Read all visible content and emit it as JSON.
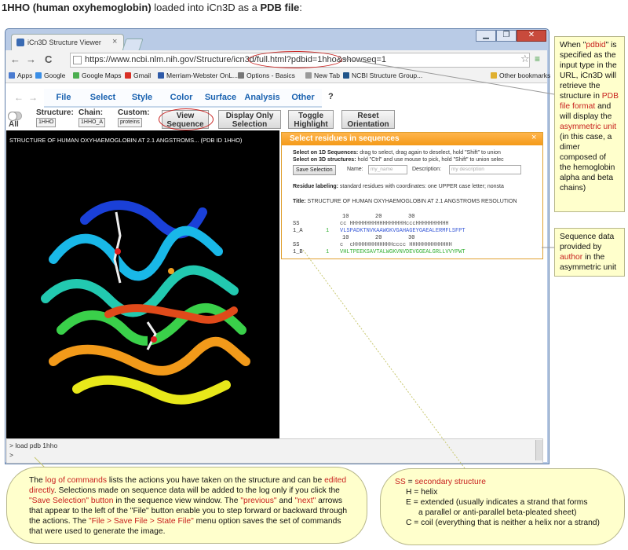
{
  "heading": {
    "bold1": "1HHO (human oxyhemoglobin)",
    "mid": " loaded into iCn3D as a ",
    "bold2": "PDB file",
    "end": ":"
  },
  "browser": {
    "tab_title": "iCn3D Structure Viewer",
    "tab_close": "×",
    "url": "https://www.ncbi.nlm.nih.gov/Structure/icn3d/full.html?pdbid=1hho&showseq=1",
    "back": "←",
    "forward": "→",
    "reload": "C",
    "star": "☆",
    "menu": "≡",
    "win_min": "▁",
    "win_restore": "❐",
    "win_close": "✕",
    "bookmarks": [
      {
        "label": "Apps",
        "color": "#4a7bd0"
      },
      {
        "label": "Google",
        "color": "#3a8ee6"
      },
      {
        "label": "Google Maps",
        "color": "#4caf50"
      },
      {
        "label": "Gmail",
        "color": "#d93025"
      },
      {
        "label": "Merriam-Webster OnL...",
        "color": "#2e5aa8"
      },
      {
        "label": "Options - Basics",
        "color": "#777777"
      },
      {
        "label": "New Tab",
        "color": "#999999"
      },
      {
        "label": "NCBI Structure Group...",
        "color": "#20558a"
      },
      {
        "label": "Other bookmarks",
        "color": "#e0b030"
      }
    ]
  },
  "icn3d": {
    "prev": "←",
    "next": "→",
    "menus": [
      "File",
      "Select",
      "Style",
      "Color",
      "Surface",
      "Analysis",
      "Other"
    ],
    "help": "?",
    "all_label": "All",
    "structure_label": "Structure:",
    "structure_value": "1HHO",
    "chain_label": "Chain:",
    "chain_value": "1HHO_A",
    "custom_label": "Custom:",
    "custom_value": "proteins",
    "buttons": {
      "view_seq_1": "View",
      "view_seq_2": "Sequence",
      "display_only_1": "Display Only",
      "display_only_2": "Selection",
      "toggle_1": "Toggle",
      "toggle_2": "Highlight",
      "reset_1": "Reset",
      "reset_2": "Orientation"
    },
    "viewer_title": "STRUCTURE OF HUMAN OXYHAEMOGLOBIN AT 2.1 ANGSTROMS... (PDB ID 1HHO)",
    "cmd_line1": "> load pdb 1hho",
    "cmd_line2": ">"
  },
  "seq_dialog": {
    "header": "Select residues in sequences",
    "close": "×",
    "line1_b": "Select on 1D Sequences:",
    "line1": " drag to select, drag again to deselect, hold \"Shift\" to union",
    "line2_b": "Select on 3D structures:",
    "line2": " hold \"Ctrl\" and use mouse to pick, hold \"Shift\" to union selec",
    "save_btn": "Save Selection",
    "name_label": "Name:",
    "name_placeholder": "my_name",
    "desc_label": "Description:",
    "desc_placeholder": "my description",
    "residue_b": "Residue labeling:",
    "residue": " standard residues with coordinates: one UPPER case letter; nonsta",
    "title_b": "Title:",
    "title": " STRUCTURE OF HUMAN OXYHAEMOGLOBIN AT 2.1 ANGSTROMS RESOLUTION",
    "ticks": "               10        20        30",
    "ss_label": "SS",
    "ss_a": "cc HHHHHHHHHHHHHHHHHcccHHHHHHHHHH",
    "chain_a": "1_A",
    "num_a": "1",
    "seq_a": "VLSPADKTNVKAAWGKVGAHAGEYGAEALERMFLSFPT",
    "ticks_b": "               10        20        30",
    "ss_b": "c  cHHHHHHHHHHHHcccc HHHHHHHHHHHHH",
    "chain_b": "1_B",
    "num_b": "1",
    "seq_b": "VHLTPEEKSAVTALWGKVNVDEVGGEALGRLLVVYPWT"
  },
  "notes": {
    "right": {
      "p1": "When \"",
      "p2": "pdbid",
      "p3": "\" is specified as the input type in the URL, iCn3D will retrieve the structure in ",
      "p4": "PDB file format",
      "p5": " and will display the ",
      "p6": "asymmetric unit",
      "p7": " (in this case, a dimer composed of the hemoglobin alpha and beta chains)"
    },
    "seq": {
      "p1": "Sequence data provided by ",
      "p2": "author",
      "p3": " in the asymmetric unit"
    },
    "log": {
      "p1": "The ",
      "p2": "log of commands",
      "p3": " lists the actions you have taken on the structure and can be ",
      "p4": "edited directly",
      "p5": ". Selections made on sequence data will be added to the log only if you click the ",
      "p6": "\"Save Selection\" button",
      "p7": " in the sequence view window. The ",
      "p8": "\"previous\"",
      "p9": " and ",
      "p10": "\"next\"",
      "p11": " arrows that appear to the left of the \"File\" button enable you to step forward or backward through the actions. The ",
      "p12": "\"File > Save File > State File\"",
      "p13": " menu option saves the set of commands that were used to generate the image."
    },
    "ss": {
      "l1a": "SS",
      "l1b": " = ",
      "l1c": "secondary structure",
      "l2": "H = helix",
      "l3": "E = extended (usually indicates a strand that forms",
      "l4": "a parallel or anti-parallel beta-pleated sheet)",
      "l5": "C = coil (everything that is neither a helix nor a strand)"
    }
  },
  "colors": {
    "accent_red": "#c8201e",
    "menu_blue": "#1a62b0",
    "dialog_orange": "#f49a18",
    "note_yellow": "#ffffcc",
    "seq_blue": "#3a5bd8",
    "seq_green": "#33b033"
  }
}
